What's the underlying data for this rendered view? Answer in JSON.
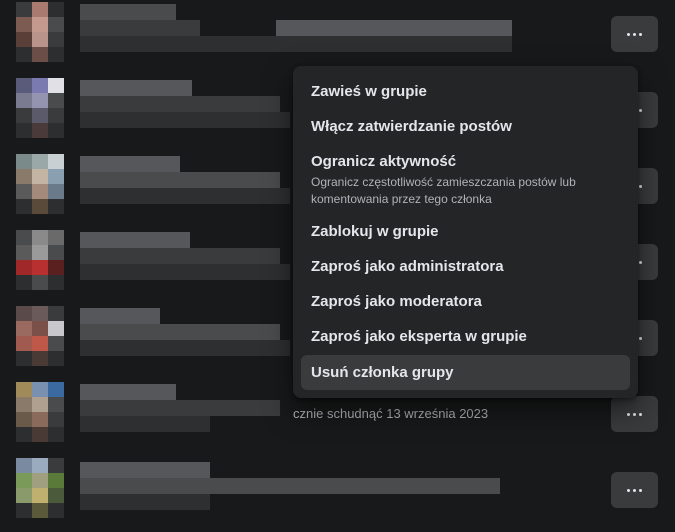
{
  "member_rows": [
    {
      "avatar_colors": [
        "#3a3b3c",
        "#a97a6f",
        "#2d2e30",
        "#7c5b52",
        "#c49a8e",
        "#4a4b4d",
        "#5a3e38",
        "#b8948a",
        "#3a3b3c",
        "#2d2e30",
        "#6b4e48",
        "#2d2e30"
      ]
    },
    {
      "avatar_colors": [
        "#5a5a7a",
        "#7a7ab0",
        "#e0e0e6",
        "#7a7a90",
        "#9494b0",
        "#4a4b4d",
        "#3a3b3c",
        "#5a5a6a",
        "#3a3b3c",
        "#2d2e30",
        "#4a3a3a",
        "#2d2e30"
      ]
    },
    {
      "avatar_colors": [
        "#7a8a8a",
        "#9aa8a8",
        "#c8d0d4",
        "#8a7a6a",
        "#c4b4a4",
        "#8aa0b0",
        "#5a5a5a",
        "#a48a7a",
        "#6a7a8a",
        "#2d2e30",
        "#5a4a3a",
        "#2d2e30"
      ]
    },
    {
      "avatar_colors": [
        "#4a4b4d",
        "#8a8a8a",
        "#6a6a6a",
        "#5a5a5a",
        "#9a9a9a",
        "#4a4b4d",
        "#a02828",
        "#b83030",
        "#5a2020",
        "#2d2e30",
        "#4a4b4d",
        "#2d2e30"
      ]
    },
    {
      "avatar_colors": [
        "#5a4a4a",
        "#6a5a5a",
        "#3a3b3c",
        "#9a6a60",
        "#7a5048",
        "#c8c8cc",
        "#a05a50",
        "#c0584a",
        "#4a4b4d",
        "#2d2e30",
        "#4a3a36",
        "#2d2e30"
      ]
    },
    {
      "avatar_colors": [
        "#a08a5a",
        "#7a90b0",
        "#3a6aa0",
        "#8a7a6a",
        "#b0a090",
        "#4a4b4d",
        "#6a5a4a",
        "#8a6a5a",
        "#3a3b3c",
        "#2d2e30",
        "#4a3a36",
        "#2d2e30"
      ]
    },
    {
      "avatar_colors": [
        "#7a8aa0",
        "#9aaabf",
        "#3a3b3c",
        "#7a9a5a",
        "#a0a080",
        "#5a7a3a",
        "#8a9a6a",
        "#c0b070",
        "#4a5a3a",
        "#2d2e30",
        "#5a5a3a",
        "#2d2e30"
      ]
    }
  ],
  "visible_row_text": "cznie schudnąć 13 września 2023",
  "more_button_icon": "more-horizontal-icon",
  "menu": {
    "items": [
      {
        "label": "Zawieś w grupie"
      },
      {
        "label": "Włącz zatwierdzanie postów"
      },
      {
        "label": "Ogranicz aktywność",
        "description": "Ogranicz częstotliwość zamieszczania postów lub komentowania przez tego członka"
      },
      {
        "label": "Zablokuj w grupie"
      },
      {
        "label": "Zaproś jako administratora"
      },
      {
        "label": "Zaproś jako moderatora"
      },
      {
        "label": "Zaproś jako eksperta w grupie"
      },
      {
        "label": "Usuń członka grupy",
        "hovered": true
      }
    ]
  },
  "colors": {
    "background": "#18191a",
    "menu_background": "#242526",
    "button_background": "#3a3b3c",
    "text_primary": "#e4e6eb",
    "text_secondary": "#b0b3b8"
  }
}
